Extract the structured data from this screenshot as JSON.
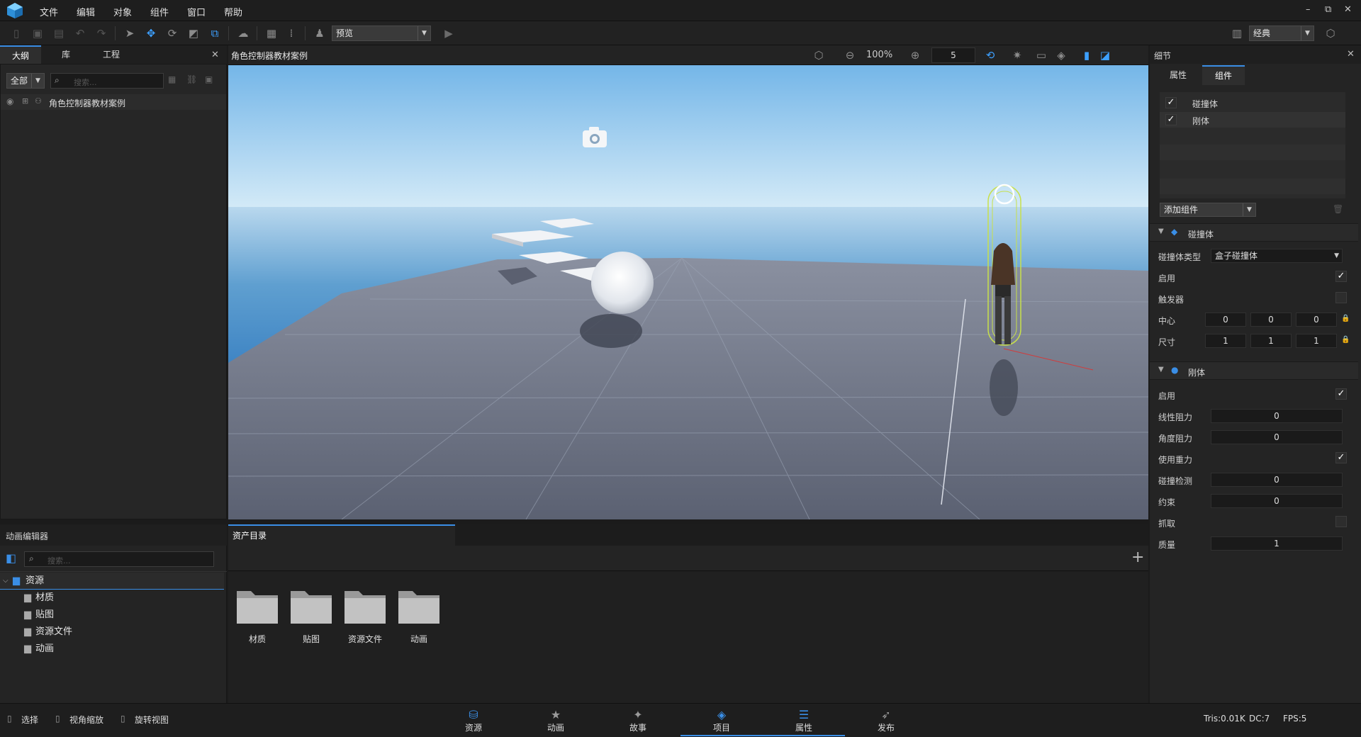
{
  "menu": [
    "文件",
    "编辑",
    "对象",
    "组件",
    "窗口",
    "帮助"
  ],
  "window_controls": [
    "–",
    "⧉",
    "✕"
  ],
  "toolbar": {
    "preview_combo": "预览",
    "layout_combo": "经典"
  },
  "left_panel": {
    "tabs": [
      "大纲",
      "库",
      "工程"
    ],
    "filter": "全部",
    "search_placeholder": "搜索...",
    "tree_root": "角色控制器教材案例"
  },
  "viewport": {
    "title": "角色控制器教材案例",
    "zoom": "100%",
    "grid_value": "5"
  },
  "details": {
    "title": "细节",
    "tabs": [
      "属性",
      "组件"
    ],
    "components": [
      {
        "name": "碰撞体",
        "checked": true
      },
      {
        "name": "刚体",
        "checked": true
      }
    ],
    "add_component": "添加组件",
    "collider": {
      "header": "碰撞体",
      "type_label": "碰撞体类型",
      "type_value": "盒子碰撞体",
      "enable_label": "启用",
      "trigger_label": "触发器",
      "center_label": "中心",
      "center": [
        "0",
        "0",
        "0"
      ],
      "size_label": "尺寸",
      "size": [
        "1",
        "1",
        "1"
      ]
    },
    "rigidbody": {
      "header": "刚体",
      "enable_label": "启用",
      "linear_drag_label": "线性阻力",
      "linear_drag": "0",
      "angular_drag_label": "角度阻力",
      "angular_drag": "0",
      "gravity_label": "使用重力",
      "collision_label": "碰撞检测",
      "collision": "0",
      "constraint_label": "约束",
      "constraint": "0",
      "grab_label": "抓取",
      "mass_label": "质量",
      "mass": "1"
    }
  },
  "anim_editor": {
    "title": "动画编辑器",
    "search_placeholder": "搜索...",
    "tree": [
      "资源",
      "材质",
      "贴图",
      "资源文件",
      "动画"
    ]
  },
  "assets": {
    "tab": "资产目录",
    "folders": [
      "材质",
      "贴图",
      "资源文件",
      "动画"
    ]
  },
  "bottom_tabs": [
    "资源",
    "动画",
    "故事",
    "项目",
    "属性",
    "发布"
  ],
  "status": {
    "hints": [
      "选择",
      "视角缩放",
      "旋转视图"
    ],
    "tris": "Tris:0.01K",
    "dc": "DC:7",
    "fps": "FPS:5"
  }
}
